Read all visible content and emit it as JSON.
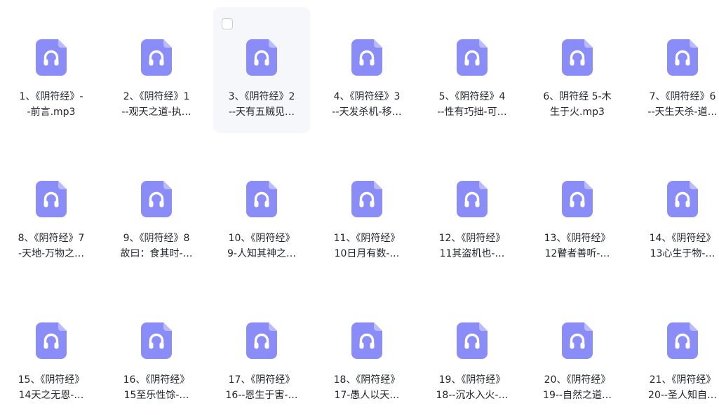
{
  "files": [
    {
      "line1": "1、《阴符经》-",
      "line2": "-前言.mp3",
      "icon": "headphones-audio-file-icon"
    },
    {
      "line1": "2、《阴符经》1",
      "line2": "--观天之道-执…",
      "icon": "headphones-audio-file-icon"
    },
    {
      "line1": "3、《阴符经》2",
      "line2": "--天有五贼见…",
      "icon": "headphones-audio-file-icon",
      "hovered": true
    },
    {
      "line1": "4、《阴符经》3",
      "line2": "--天发杀机-移…",
      "icon": "headphones-audio-file-icon"
    },
    {
      "line1": "5、《阴符经》4",
      "line2": "--性有巧拙-可…",
      "icon": "headphones-audio-file-icon"
    },
    {
      "line1": "6、阴符经 5-木",
      "line2": "生于火.mp3",
      "icon": "headphones-audio-file-icon"
    },
    {
      "line1": "7、《阴符经》6",
      "line2": "--天生天杀-道…",
      "icon": "headphones-audio-file-icon"
    },
    {
      "line1": "8、《阴符经》7",
      "line2": "-天地-万物之…",
      "icon": "headphones-audio-file-icon"
    },
    {
      "line1": "9、《阴符经》8",
      "line2": "故曰：食其时-…",
      "icon": "headphones-audio-file-icon"
    },
    {
      "line1": "10、《阴符经》",
      "line2": "9-人知其神之…",
      "icon": "headphones-audio-file-icon"
    },
    {
      "line1": "11、《阴符经》",
      "line2": "10日月有数-…",
      "icon": "headphones-audio-file-icon"
    },
    {
      "line1": "12、《阴符经》",
      "line2": "11其盗机也-…",
      "icon": "headphones-audio-file-icon"
    },
    {
      "line1": "13、《阴符经》",
      "line2": "12瞽者善听-…",
      "icon": "headphones-audio-file-icon"
    },
    {
      "line1": "14、《阴符经》",
      "line2": "13心生于物-…",
      "icon": "headphones-audio-file-icon"
    },
    {
      "line1": "15、《阴符经》",
      "line2": "14天之无恩-…",
      "icon": "headphones-audio-file-icon"
    },
    {
      "line1": "16、《阴符经》",
      "line2": "15至乐性馀-…",
      "icon": "headphones-audio-file-icon"
    },
    {
      "line1": "17、《阴符经》",
      "line2": "16--恩生于害-…",
      "icon": "headphones-audio-file-icon"
    },
    {
      "line1": "18、《阴符经》",
      "line2": "17-愚人以天…",
      "icon": "headphones-audio-file-icon"
    },
    {
      "line1": "19、《阴符经》",
      "line2": "18--沉水入火-…",
      "icon": "headphones-audio-file-icon"
    },
    {
      "line1": "20、《阴符经》",
      "line2": "19--自然之道…",
      "icon": "headphones-audio-file-icon"
    },
    {
      "line1": "21、《阴符经》",
      "line2": "20--圣人知自…",
      "icon": "headphones-audio-file-icon"
    }
  ],
  "colors": {
    "icon_fill": "#8a8cf8",
    "icon_fold": "#b9baff",
    "icon_glyph": "#ffffff",
    "text": "#1f2329",
    "hover_bg": "#f6f7fb"
  }
}
